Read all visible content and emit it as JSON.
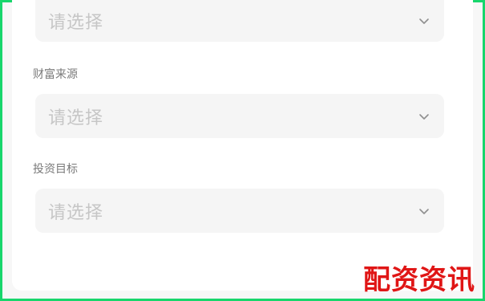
{
  "form": {
    "fields": [
      {
        "label": "",
        "value": "请选择",
        "icon": "chevron-down-icon"
      },
      {
        "label": "财富来源",
        "value": "请选择",
        "icon": "chevron-down-icon"
      },
      {
        "label": "投资目标",
        "value": "请选择",
        "icon": "chevron-down-icon"
      }
    ]
  },
  "watermark": {
    "text": "配资资讯"
  },
  "colors": {
    "frame_border": "#18d66c",
    "select_background": "#f5f5f5",
    "placeholder_text": "#c6c6c6",
    "label_text": "#7a7a7a",
    "watermark": "#e01616"
  }
}
